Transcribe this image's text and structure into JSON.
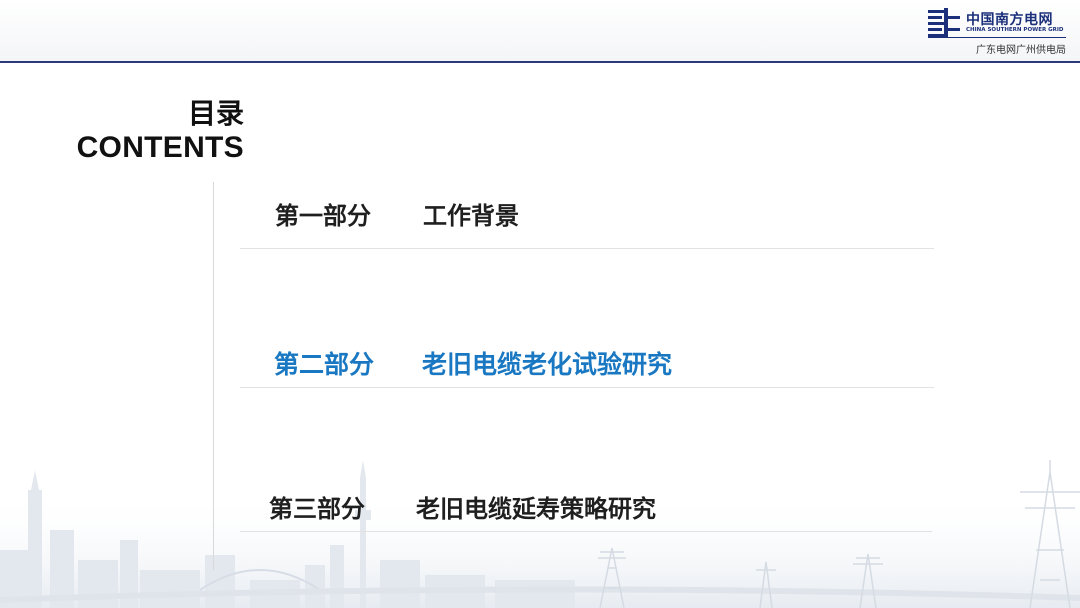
{
  "header": {
    "logo": {
      "name_cn": "中国南方电网",
      "name_en": "CHINA SOUTHERN POWER GRID",
      "sub_org": "广东电网广州供电局",
      "brand_color": "#1b2f7a"
    },
    "rule_color": "#2b3a78"
  },
  "toc": {
    "title": "目录",
    "subtitle": "CONTENTS",
    "items": [
      {
        "part": "第一部分",
        "name": "工作背景",
        "color": "#1f1f1f"
      },
      {
        "part": "第二部分",
        "name": "老旧电缆老化试验研究",
        "color": "#1a78c2",
        "highlighted": true
      },
      {
        "part": "第三部分",
        "name": "老旧电缆延寿策略研究",
        "color": "#1f1f1f"
      }
    ]
  },
  "background": {
    "motif": "faded city skyline with power transmission towers",
    "icons": [
      "city-skyline-icon",
      "transmission-tower-icon"
    ]
  }
}
